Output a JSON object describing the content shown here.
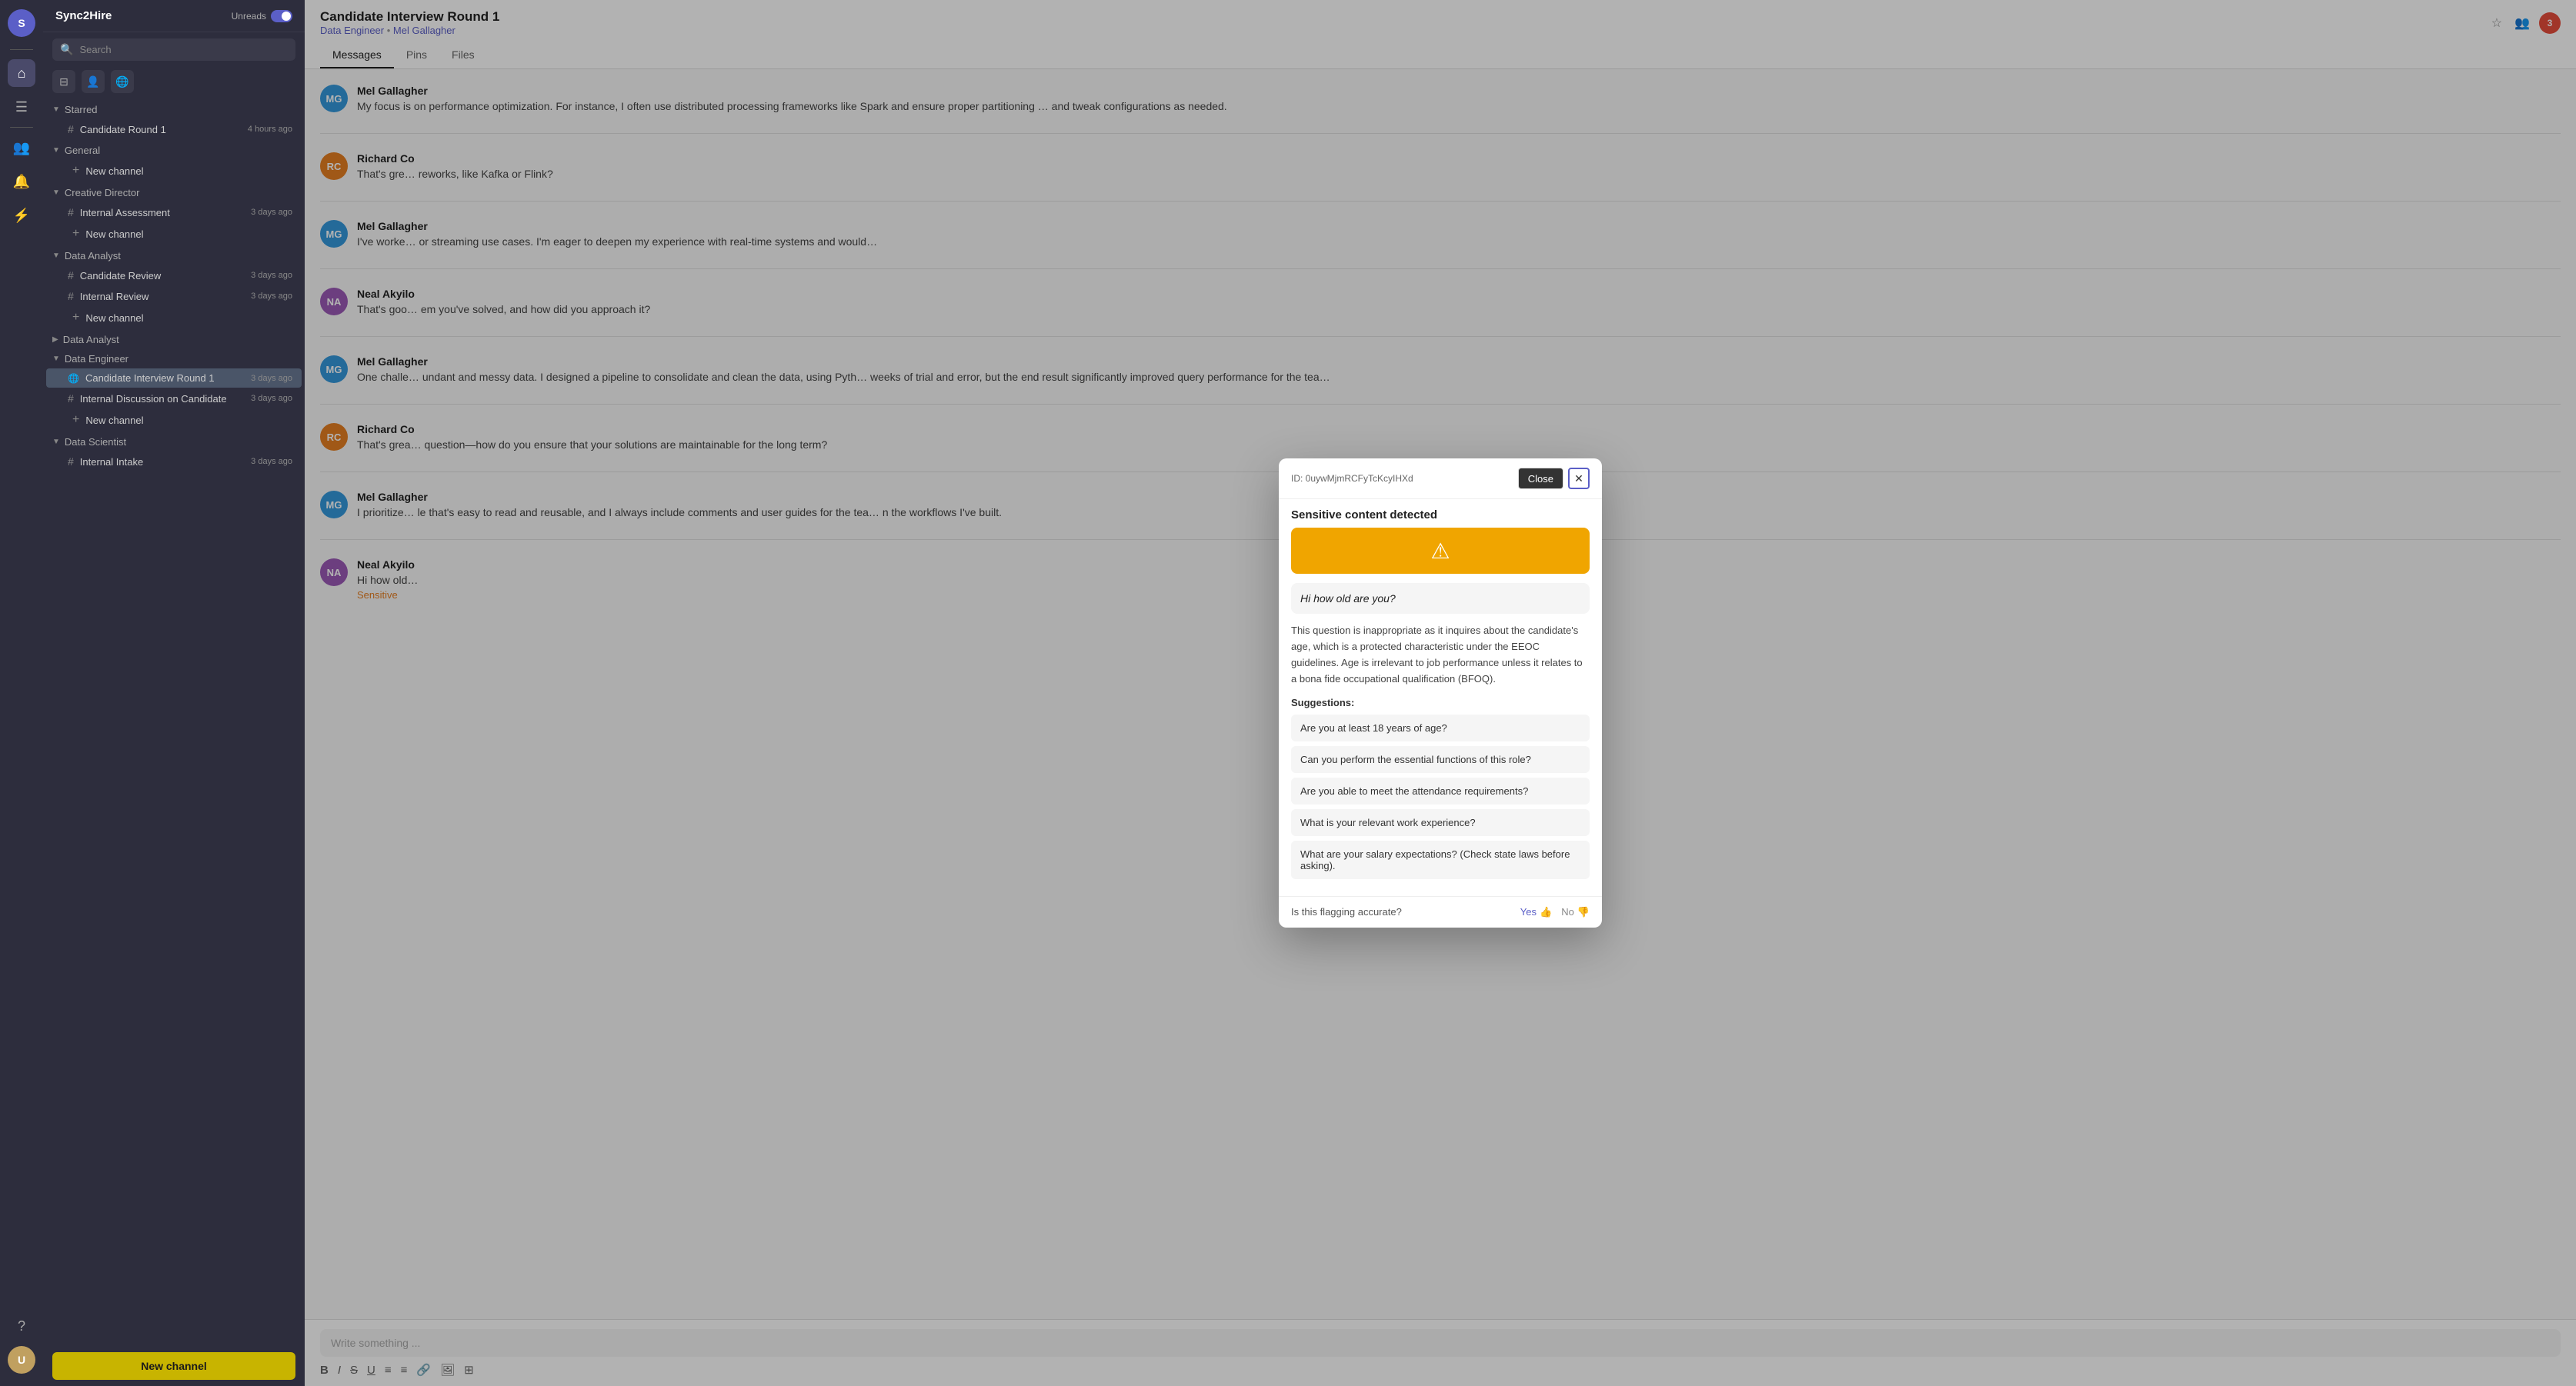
{
  "app": {
    "workspace": "Sync2Hire",
    "unread_label": "Unreads",
    "new_channel_btn": "New channel",
    "search_placeholder": "Search"
  },
  "sidebar": {
    "starred_label": "Starred",
    "starred_channels": [
      {
        "name": "Candidate Round 1",
        "time": "4 hours ago",
        "type": "hash"
      }
    ],
    "general_label": "General",
    "general_channels": [],
    "creative_director_label": "Creative Director",
    "creative_director_channels": [
      {
        "name": "Internal Assessment",
        "time": "3 days ago",
        "type": "hash"
      }
    ],
    "data_analyst_label": "Data Analyst",
    "data_analyst_channels": [
      {
        "name": "Candidate Review",
        "time": "3 days ago",
        "type": "hash"
      },
      {
        "name": "Internal Review",
        "time": "3 days ago",
        "type": "hash"
      }
    ],
    "data_analyst2_label": "Data Analyst",
    "data_engineer_label": "Data Engineer",
    "data_engineer_channels": [
      {
        "name": "Candidate Interview Round 1",
        "time": "3 days ago",
        "type": "globe",
        "active": true
      },
      {
        "name": "Internal Discussion on Candidate",
        "time": "3 days ago",
        "type": "hash"
      }
    ],
    "data_scientist_label": "Data Scientist",
    "data_scientist_channels": [
      {
        "name": "Internal Intake",
        "time": "3 days ago",
        "type": "hash"
      }
    ]
  },
  "main": {
    "channel_title": "Candidate Interview Round 1",
    "channel_subtitle_role": "Data Engineer",
    "channel_subtitle_person": "Mel Gallagher",
    "tabs": [
      "Messages",
      "Pins",
      "Files"
    ],
    "active_tab": "Messages",
    "write_placeholder": "Write something ...",
    "messages": [
      {
        "author": "Mel Gallagher",
        "initials": "MG",
        "av_class": "av-mel",
        "time": "",
        "text": "My focus is on performance optimization. For instance, I often use distributed processing frameworks like Spark and ensure proper partitioning ... and tweak configurations as needed."
      },
      {
        "author": "Richard Co",
        "initials": "RC",
        "av_class": "av-richard",
        "time": "",
        "text": "That's gre ... reworks, like Kafka or Flink?"
      },
      {
        "author": "Mel Gallagher",
        "initials": "MG",
        "av_class": "av-mel",
        "time": "",
        "text": "I've worke ... or streaming use cases. I'm eager to deepen my experience with real-time systems and would ..."
      },
      {
        "author": "Neal Akyilo",
        "initials": "NA",
        "av_class": "av-neal",
        "time": "",
        "text": "That's goo ... em you've solved, and how did you approach it?"
      },
      {
        "author": "Mel Gallagher",
        "initials": "MG",
        "av_class": "av-mel",
        "time": "",
        "text": "One challe ... undant and messy data. I designed a pipeline to consolidate and clean the data, using Pyth ... weeks of trial and error, but the end result significantly improved query performance for the tea ..."
      },
      {
        "author": "Richard Co",
        "initials": "RC",
        "av_class": "av-richard",
        "time": "",
        "text": "That's grea ... question—how do you ensure that your solutions are maintainable for the long term?"
      },
      {
        "author": "Mel Gallagher",
        "initials": "MG",
        "av_class": "av-mel",
        "time": "",
        "text": "I prioritize ... le that's easy to read and reusable, and I always include comments and user guides for the tea ... n the workflows I've built."
      },
      {
        "author": "Neal Akyilo",
        "initials": "NA",
        "av_class": "av-neal",
        "time": "",
        "text": "Hi how old ...",
        "sensitive_label": "Sensitive"
      }
    ],
    "toolbar": [
      "B",
      "I",
      "S",
      "U",
      "≡",
      "≡",
      "🔗",
      "🖼",
      "⊞"
    ]
  },
  "modal": {
    "id_label": "ID: 0uywMjmRCFyTcKcyIHXd",
    "title": "Sensitive content detected",
    "close_btn": "Close",
    "flagged_text": "Hi how old are you?",
    "explanation": "This question is inappropriate as it inquires about the candidate's age, which is a protected characteristic under the EEOC guidelines. Age is irrelevant to job performance unless it relates to a bona fide occupational qualification (BFOQ).",
    "suggestions_label": "Suggestions:",
    "suggestions": [
      "Are you at least 18 years of age?",
      "Can you perform the essential functions of this role?",
      "Are you able to meet the attendance requirements?",
      "What is your relevant work experience?",
      "What are your salary expectations? (Check state laws before asking)."
    ],
    "feedback_question": "Is this flagging accurate?",
    "yes_label": "Yes",
    "no_label": "No"
  }
}
